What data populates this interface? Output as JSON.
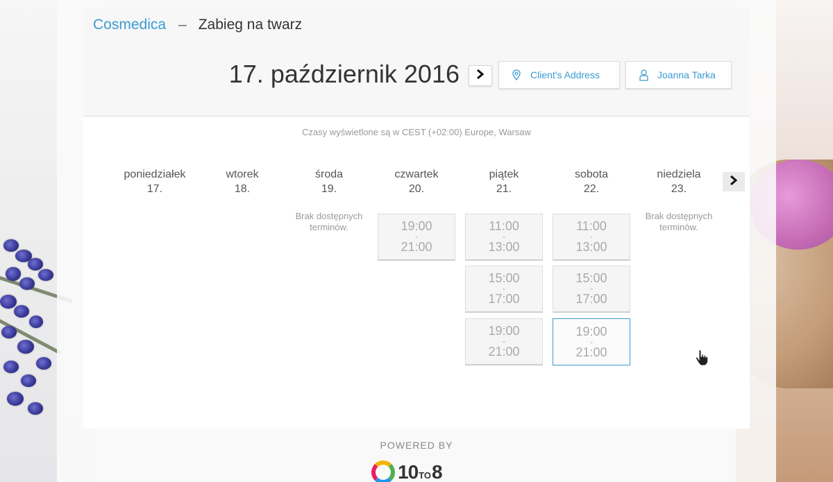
{
  "header": {
    "brand": "Cosmedica",
    "separator": "–",
    "service": "Zabieg na twarz",
    "date_title": "17. październik 2016",
    "address_button": "Client's Address",
    "employee_button": "Joanna Tarka"
  },
  "timezone_note": "Czasy wyświetlone są w CEST (+02:00) Europe, Warsaw",
  "week": {
    "days": [
      {
        "name": "poniedziałek",
        "date": "17.",
        "slots": [],
        "no_slots_text": ""
      },
      {
        "name": "wtorek",
        "date": "18.",
        "slots": [],
        "no_slots_text": ""
      },
      {
        "name": "środa",
        "date": "19.",
        "slots": [],
        "no_slots_text": "Brak dostępnych terminów."
      },
      {
        "name": "czwartek",
        "date": "20.",
        "slots": [
          {
            "start": "19:00",
            "sep": "-",
            "end": "21:00"
          }
        ]
      },
      {
        "name": "piątek",
        "date": "21.",
        "slots": [
          {
            "start": "11:00",
            "sep": "-",
            "end": "13:00"
          },
          {
            "start": "15:00",
            "sep": "-",
            "end": "17:00"
          },
          {
            "start": "19:00",
            "sep": "-",
            "end": "21:00"
          }
        ]
      },
      {
        "name": "sobota",
        "date": "22.",
        "slots": [
          {
            "start": "11:00",
            "sep": "-",
            "end": "13:00"
          },
          {
            "start": "15:00",
            "sep": "-",
            "end": "17:00"
          },
          {
            "start": "19:00",
            "sep": "-",
            "end": "21:00"
          }
        ]
      },
      {
        "name": "niedziela",
        "date": "23.",
        "slots": [],
        "no_slots_text": "Brak dostępnych terminów."
      }
    ]
  },
  "footer": {
    "powered_by": "POWERED BY",
    "logo_text_a": "10",
    "logo_text_to": "TO",
    "logo_text_b": "8"
  },
  "icons": {
    "next_week": "chevron-right-icon",
    "address": "map-pin-icon",
    "employee": "user-icon",
    "next_days": "chevron-right-icon"
  },
  "colors": {
    "accent": "#3a9bd3",
    "slot_bg": "#f5f5f5",
    "slot_text": "#aaaaaa"
  }
}
